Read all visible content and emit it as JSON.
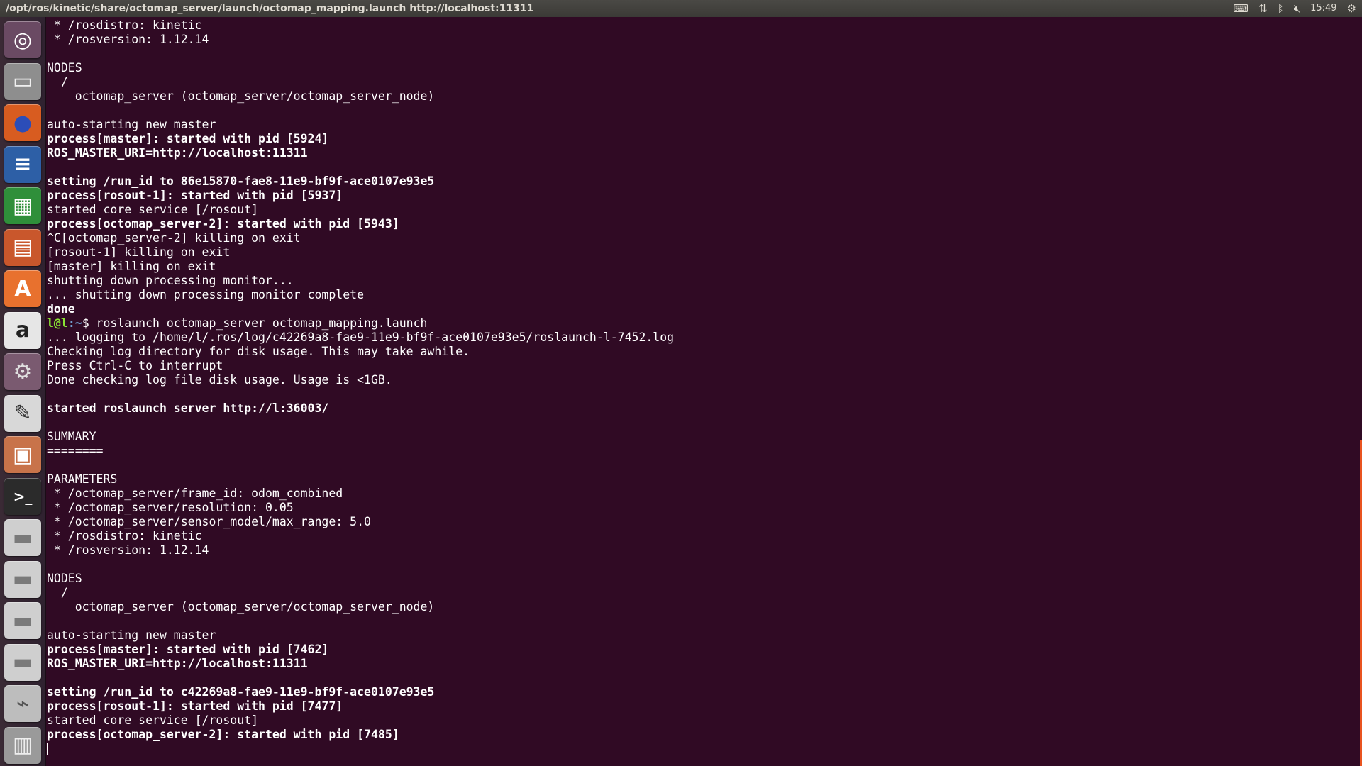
{
  "topbar": {
    "title": "/opt/ros/kinetic/share/octomap_server/launch/octomap_mapping.launch http://localhost:11311",
    "clock": "15:49"
  },
  "launcher": {
    "items": [
      {
        "name": "dash-home-button",
        "icon": "ubuntu-logo-icon",
        "glyph": "◎",
        "bg": "#6a4a63",
        "fg": "#ffffff"
      },
      {
        "name": "files-launcher",
        "icon": "file-cabinet-icon",
        "glyph": "▭",
        "bg": "#8e8e8e",
        "fg": "#f0f0f0"
      },
      {
        "name": "firefox-launcher",
        "icon": "firefox-icon",
        "glyph": "●",
        "bg": "#d85c20",
        "fg": "#2c4db8"
      },
      {
        "name": "libreoffice-writer-launcher",
        "icon": "writer-document-icon",
        "glyph": "≡",
        "bg": "#2d5fa6",
        "fg": "#ffffff"
      },
      {
        "name": "libreoffice-calc-launcher",
        "icon": "calc-spreadsheet-icon",
        "glyph": "▦",
        "bg": "#2f8f3a",
        "fg": "#ffffff"
      },
      {
        "name": "libreoffice-impress-launcher",
        "icon": "impress-presentation-icon",
        "glyph": "▤",
        "bg": "#c9572c",
        "fg": "#ffffff"
      },
      {
        "name": "software-center-launcher",
        "icon": "shopping-bag-icon",
        "glyph": "A",
        "bg": "#e8712e",
        "fg": "#ffffff"
      },
      {
        "name": "amazon-launcher",
        "icon": "amazon-icon",
        "glyph": "a",
        "bg": "#e6e6e6",
        "fg": "#222222"
      },
      {
        "name": "system-settings-launcher",
        "icon": "gear-wrench-icon",
        "glyph": "⚙",
        "bg": "#7a5a70",
        "fg": "#e0e0e0"
      },
      {
        "name": "text-editor-launcher",
        "icon": "text-editor-icon",
        "glyph": "✎",
        "bg": "#d8d8d8",
        "fg": "#333333"
      },
      {
        "name": "archive-manager-launcher",
        "icon": "archive-box-icon",
        "glyph": "▣",
        "bg": "#c8734a",
        "fg": "#ffffff"
      },
      {
        "name": "terminal-launcher",
        "icon": "terminal-prompt-icon",
        "glyph": ">_",
        "bg": "#2b2b2b",
        "fg": "#ffffff"
      },
      {
        "name": "drive-1-launcher",
        "icon": "hard-drive-icon",
        "glyph": "▬",
        "bg": "#cfcfcf",
        "fg": "#7a7a7a"
      },
      {
        "name": "drive-2-launcher",
        "icon": "hard-drive-icon",
        "glyph": "▬",
        "bg": "#cfcfcf",
        "fg": "#7a7a7a"
      },
      {
        "name": "drive-3-launcher",
        "icon": "hard-drive-icon",
        "glyph": "▬",
        "bg": "#cfcfcf",
        "fg": "#7a7a7a"
      },
      {
        "name": "drive-4-launcher",
        "icon": "hard-drive-icon",
        "glyph": "▬",
        "bg": "#cfcfcf",
        "fg": "#7a7a7a"
      },
      {
        "name": "usb-drive-launcher",
        "icon": "usb-drive-icon",
        "glyph": "⌁",
        "bg": "#bdbdbd",
        "fg": "#555555"
      },
      {
        "name": "trash-launcher",
        "icon": "trash-icon",
        "glyph": "▥",
        "bg": "#9a9a9a",
        "fg": "#eeeeee"
      }
    ]
  },
  "terminal": {
    "lines": [
      {
        "t": " * /rosdistro: kinetic"
      },
      {
        "t": " * /rosversion: 1.12.14"
      },
      {
        "t": ""
      },
      {
        "t": "NODES"
      },
      {
        "t": "  /"
      },
      {
        "t": "    octomap_server (octomap_server/octomap_server_node)"
      },
      {
        "t": ""
      },
      {
        "t": "auto-starting new master"
      },
      {
        "t": "process[master]: started with pid [5924]",
        "b": true
      },
      {
        "t": "ROS_MASTER_URI=http://localhost:11311",
        "b": true
      },
      {
        "t": ""
      },
      {
        "t": "setting /run_id to 86e15870-fae8-11e9-bf9f-ace0107e93e5",
        "b": true
      },
      {
        "t": "process[rosout-1]: started with pid [5937]",
        "b": true
      },
      {
        "t": "started core service [/rosout]"
      },
      {
        "t": "process[octomap_server-2]: started with pid [5943]",
        "b": true
      },
      {
        "t": "^C[octomap_server-2] killing on exit"
      },
      {
        "t": "[rosout-1] killing on exit"
      },
      {
        "t": "[master] killing on exit"
      },
      {
        "t": "shutting down processing monitor..."
      },
      {
        "t": "... shutting down processing monitor complete"
      },
      {
        "t": "done",
        "b": true
      },
      {
        "prompt": true,
        "user": "l@l",
        "path": ":~",
        "cmd": "$ roslaunch octomap_server octomap_mapping.launch"
      },
      {
        "t": "... logging to /home/l/.ros/log/c42269a8-fae9-11e9-bf9f-ace0107e93e5/roslaunch-l-7452.log"
      },
      {
        "t": "Checking log directory for disk usage. This may take awhile."
      },
      {
        "t": "Press Ctrl-C to interrupt"
      },
      {
        "t": "Done checking log file disk usage. Usage is <1GB."
      },
      {
        "t": ""
      },
      {
        "t": "started roslaunch server http://l:36003/",
        "b": true
      },
      {
        "t": ""
      },
      {
        "t": "SUMMARY"
      },
      {
        "t": "========"
      },
      {
        "t": ""
      },
      {
        "t": "PARAMETERS"
      },
      {
        "t": " * /octomap_server/frame_id: odom_combined"
      },
      {
        "t": " * /octomap_server/resolution: 0.05"
      },
      {
        "t": " * /octomap_server/sensor_model/max_range: 5.0"
      },
      {
        "t": " * /rosdistro: kinetic"
      },
      {
        "t": " * /rosversion: 1.12.14"
      },
      {
        "t": ""
      },
      {
        "t": "NODES"
      },
      {
        "t": "  /"
      },
      {
        "t": "    octomap_server (octomap_server/octomap_server_node)"
      },
      {
        "t": ""
      },
      {
        "t": "auto-starting new master"
      },
      {
        "t": "process[master]: started with pid [7462]",
        "b": true
      },
      {
        "t": "ROS_MASTER_URI=http://localhost:11311",
        "b": true
      },
      {
        "t": ""
      },
      {
        "t": "setting /run_id to c42269a8-fae9-11e9-bf9f-ace0107e93e5",
        "b": true
      },
      {
        "t": "process[rosout-1]: started with pid [7477]",
        "b": true
      },
      {
        "t": "started core service [/rosout]"
      },
      {
        "t": "process[octomap_server-2]: started with pid [7485]",
        "b": true
      },
      {
        "cursor": true
      }
    ]
  }
}
